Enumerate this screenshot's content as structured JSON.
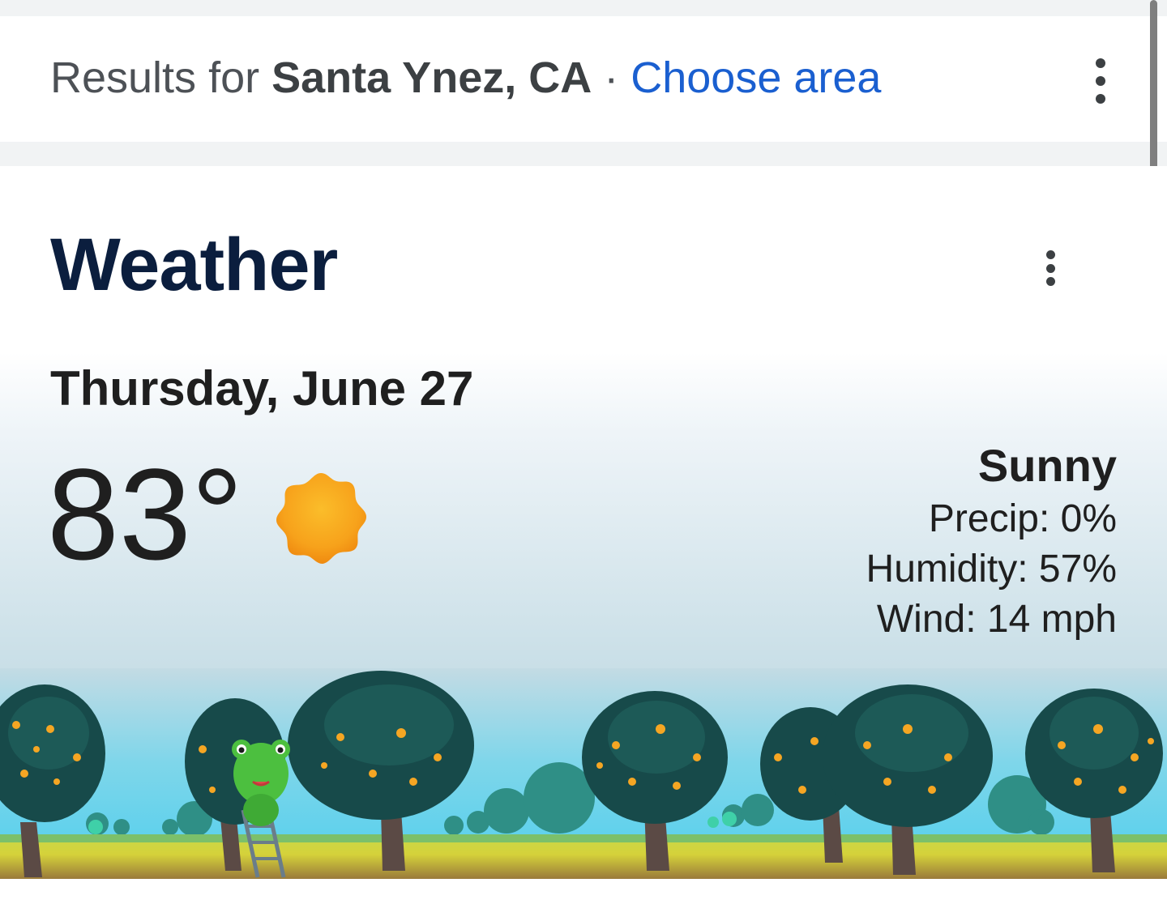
{
  "results_bar": {
    "prefix": "Results for",
    "location": "Santa Ynez, CA",
    "separator": "·",
    "choose_area": "Choose area",
    "menu_icon": "more-vert-icon"
  },
  "weather": {
    "title": "Weather",
    "menu_icon": "more-vert-icon",
    "date": "Thursday, June 27",
    "temperature": "83°",
    "condition_icon": "sunny-icon",
    "condition": "Sunny",
    "precip": "Precip: 0%",
    "humidity": "Humidity: 57%",
    "wind": "Wind: 14 mph",
    "illustration": "orange-orchard-frog-illustration"
  },
  "colors": {
    "link": "#1a5fd0",
    "title": "#0b1e3e",
    "sun": "#f7a21b"
  }
}
